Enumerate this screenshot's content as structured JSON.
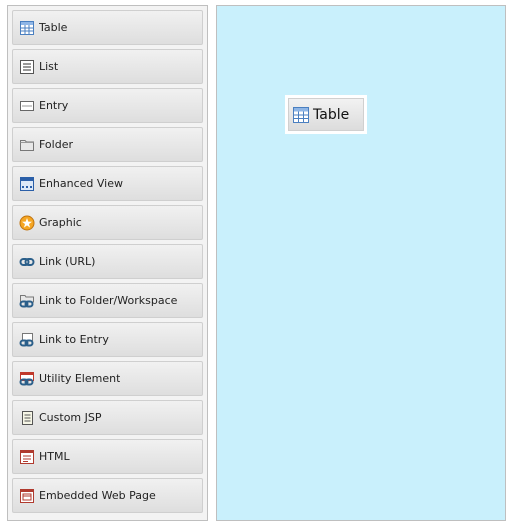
{
  "palette": {
    "items": [
      {
        "label": "Table",
        "icon": "table-icon"
      },
      {
        "label": "List",
        "icon": "list-icon"
      },
      {
        "label": "Entry",
        "icon": "entry-icon"
      },
      {
        "label": "Folder",
        "icon": "folder-icon"
      },
      {
        "label": "Enhanced View",
        "icon": "enhanced-view-icon"
      },
      {
        "label": "Graphic",
        "icon": "graphic-icon"
      },
      {
        "label": "Link (URL)",
        "icon": "link-icon"
      },
      {
        "label": "Link to Folder/Workspace",
        "icon": "link-folder-icon"
      },
      {
        "label": "Link to Entry",
        "icon": "link-entry-icon"
      },
      {
        "label": "Utility Element",
        "icon": "utility-element-icon"
      },
      {
        "label": "Custom JSP",
        "icon": "custom-jsp-icon"
      },
      {
        "label": "HTML",
        "icon": "html-icon"
      },
      {
        "label": "Embedded Web Page",
        "icon": "embedded-web-page-icon"
      }
    ]
  },
  "canvas": {
    "background": "#c9f0fc",
    "item": {
      "label": "Table",
      "icon": "table-icon"
    }
  }
}
